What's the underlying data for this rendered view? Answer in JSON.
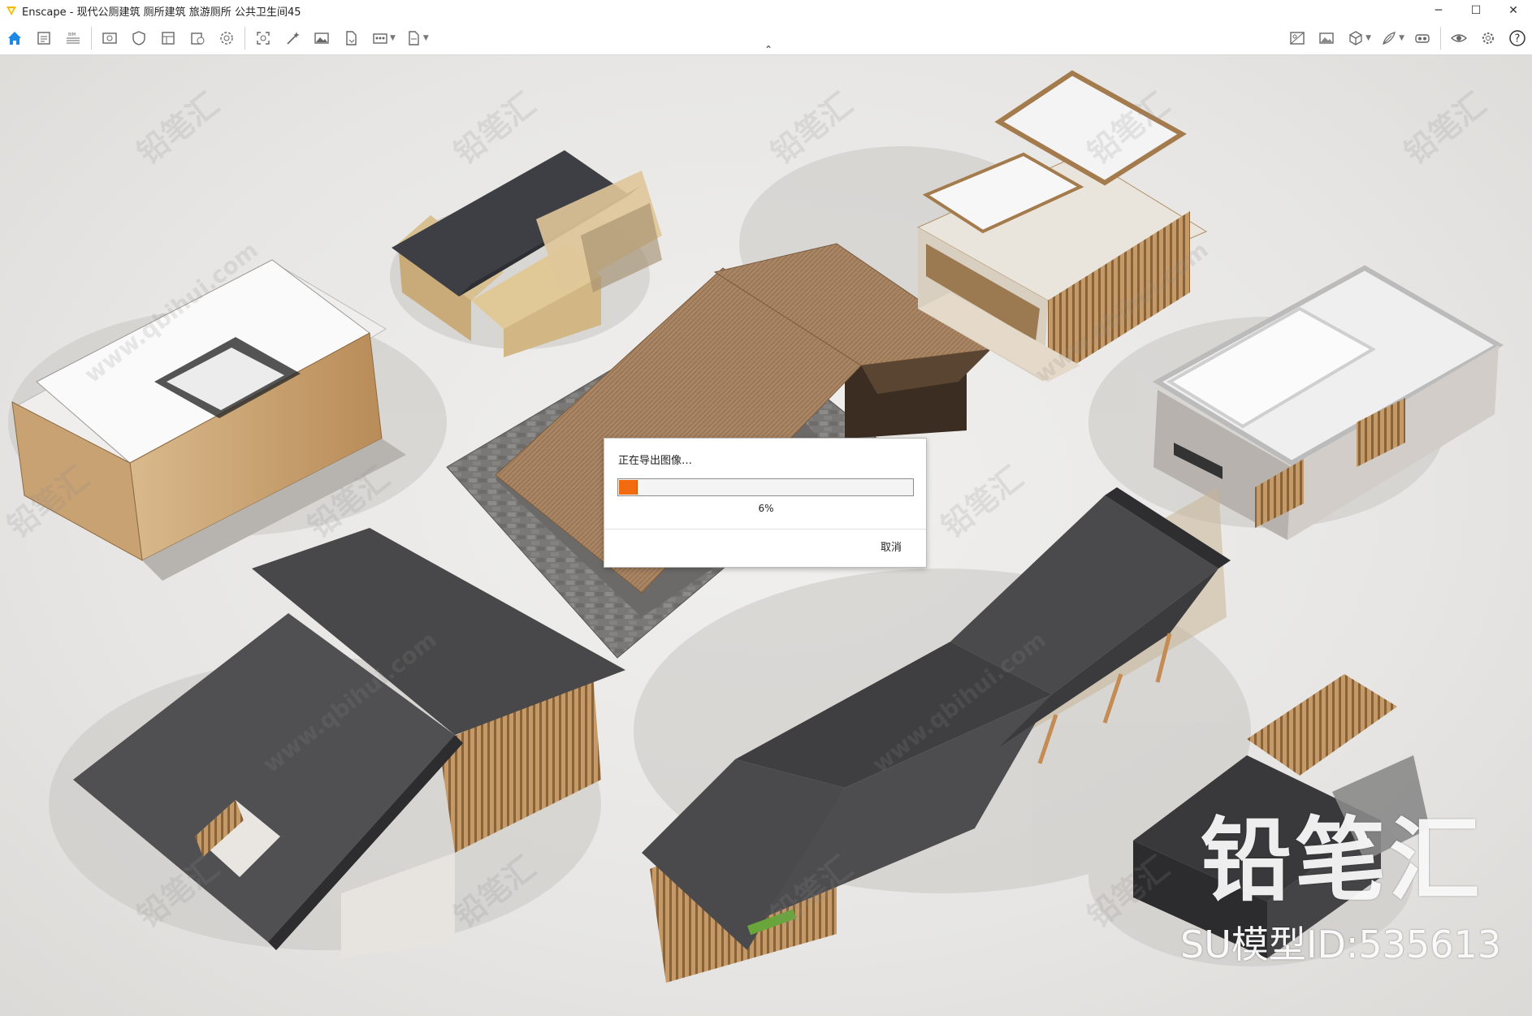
{
  "window": {
    "app_name": "Enscape",
    "title": "Enscape - 现代公厕建筑 厕所建筑 旅游厕所 公共卫生间45",
    "minimize_glyph": "─",
    "maximize_glyph": "☐",
    "close_glyph": "✕"
  },
  "toolbar": {
    "left_icons": [
      "home-icon",
      "document-icon",
      "bim-icon",
      "view-icon",
      "shield-icon",
      "layers-icon",
      "book-camera-icon",
      "settings-wheel-icon",
      "screenshot-icon",
      "magic-wand-icon",
      "image-icon",
      "file-export-icon",
      "batch-render-icon",
      "panorama-icon"
    ],
    "right_icons": [
      "image-compare-icon",
      "gallery-icon",
      "cube-icon",
      "feather-icon",
      "vr-headset-icon",
      "eye-icon",
      "gear-icon",
      "help-icon"
    ],
    "collapse_glyph": "⌃",
    "help_label": "?",
    "accent_color": "#1e88e5"
  },
  "dialog": {
    "title": "正在导出图像…",
    "progress_percent": 6,
    "progress_label": "6%",
    "cancel_label": "取消",
    "progress_color": "#f26b0f"
  },
  "watermark": {
    "repeat_text": "铅笔汇",
    "site_text": "www.qbihui.com",
    "logo_text": "铅笔汇",
    "model_id": "SU模型ID:535613"
  }
}
